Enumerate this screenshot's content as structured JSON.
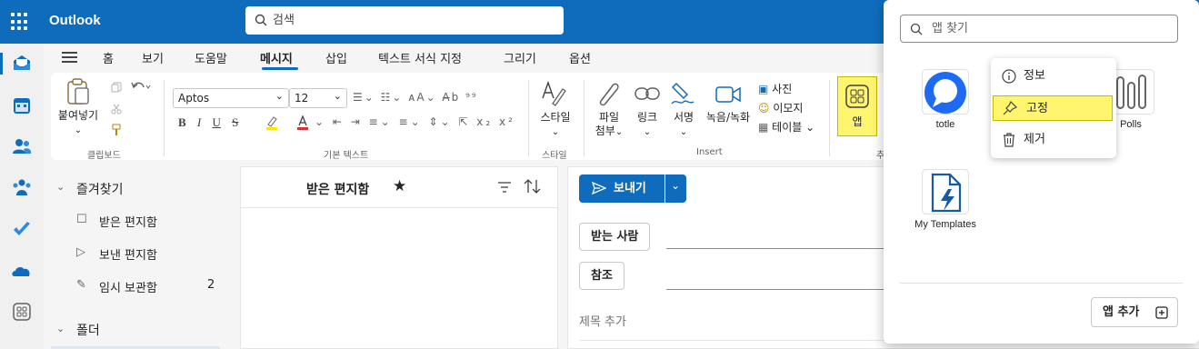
{
  "app": {
    "name": "Outlook"
  },
  "search": {
    "placeholder": "검색"
  },
  "ribbon_tabs": [
    "홈",
    "보기",
    "도움말",
    "메시지",
    "삽입",
    "텍스트 서식 지정",
    "그리기",
    "옵션"
  ],
  "active_tab": "메시지",
  "clipboard": {
    "paste": "붙여넣기",
    "group": "클립보드"
  },
  "text": {
    "font": "Aptos",
    "size": "12",
    "group": "기본 텍스트"
  },
  "styles": {
    "label": "스타일",
    "group": "스타일"
  },
  "insert": {
    "attach_line1": "파일",
    "attach_line2": "첨부",
    "link": "링크",
    "signature": "서명",
    "recording": "녹음/녹화",
    "photo": "사진",
    "emoji": "이모지",
    "table": "테이블",
    "group": "Insert"
  },
  "apps_button": {
    "label": "앱"
  },
  "cut_group_char": "추",
  "nav": {
    "favorites": "즐겨찾기",
    "inbox": "받은 편지함",
    "sent": "보낸 편지함",
    "drafts": "임시 보관함",
    "drafts_count": "2",
    "folders": "폴더"
  },
  "list": {
    "title": "받은 편지함"
  },
  "compose": {
    "send": "보내기",
    "to": "받는 사람",
    "cc": "참조",
    "subject_placeholder": "제목 추가"
  },
  "apps_panel": {
    "search_placeholder": "앱 찾기",
    "apps": [
      {
        "name": "totle"
      },
      {
        "name": "Polls"
      },
      {
        "name": "My Templates"
      }
    ],
    "context_menu": {
      "info": "정보",
      "pin": "고정",
      "remove": "제거"
    },
    "add_app": "앱 추가"
  },
  "colors": {
    "brand": "#0f6cbd",
    "highlight": "#fff56e"
  }
}
